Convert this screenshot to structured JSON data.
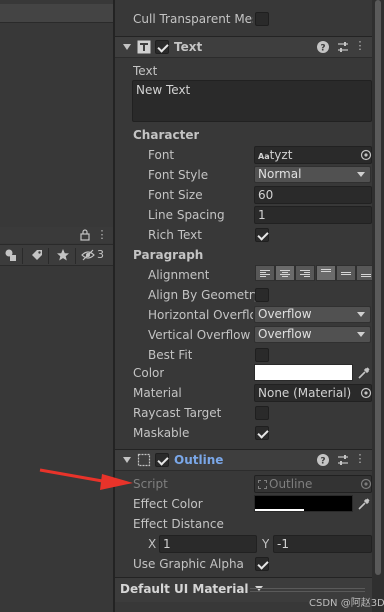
{
  "inspector": {
    "cull_label": "Cull Transparent Mes",
    "text_component": {
      "title": "Text",
      "text_label": "Text",
      "text_value": "New Text",
      "character_header": "Character",
      "font_label": "Font",
      "font_value": "tyzt",
      "font_icon": "Aa",
      "font_style_label": "Font Style",
      "font_style_value": "Normal",
      "font_size_label": "Font Size",
      "font_size_value": "60",
      "line_spacing_label": "Line Spacing",
      "line_spacing_value": "1",
      "rich_text_label": "Rich Text",
      "paragraph_header": "Paragraph",
      "alignment_label": "Alignment",
      "align_by_geometry_label": "Align By Geometry",
      "horizontal_overflow_label": "Horizontal Overflo",
      "horizontal_overflow_value": "Overflow",
      "vertical_overflow_label": "Vertical Overflow",
      "vertical_overflow_value": "Overflow",
      "best_fit_label": "Best Fit",
      "color_label": "Color",
      "material_label": "Material",
      "material_value": "None (Material)",
      "raycast_label": "Raycast Target",
      "maskable_label": "Maskable"
    },
    "outline_component": {
      "title": "Outline",
      "script_label": "Script",
      "script_value": "Outline",
      "effect_color_label": "Effect Color",
      "effect_distance_label": "Effect Distance",
      "x_label": "X",
      "x_value": "1",
      "y_label": "Y",
      "y_value": "-1",
      "use_graphic_alpha_label": "Use Graphic Alpha"
    },
    "bottom_material": "Default UI Material"
  },
  "left": {
    "hidden_count": "3"
  },
  "watermark": "CSDN @阿赵3D",
  "colors": {
    "accent_link": "#7aa7e8",
    "annotation_arrow": "#e8332a",
    "text_color_swatch": "#ffffff",
    "effect_color_swatch": "#000000"
  }
}
